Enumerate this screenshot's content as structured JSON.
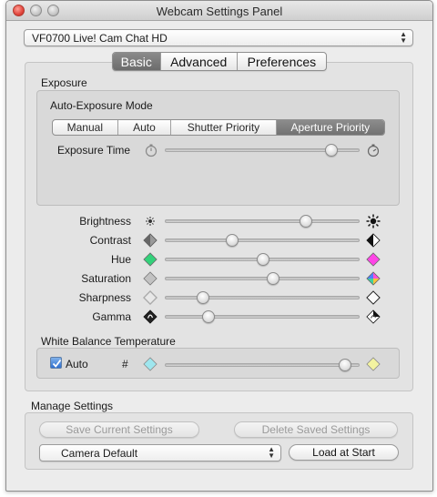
{
  "window": {
    "title": "Webcam Settings Panel"
  },
  "camera_select": {
    "value": "VF0700 Live! Cam Chat HD"
  },
  "tabs": [
    {
      "label": "Basic",
      "selected": true
    },
    {
      "label": "Advanced",
      "selected": false
    },
    {
      "label": "Preferences",
      "selected": false
    }
  ],
  "exposure": {
    "group_label": "Exposure",
    "mode_label": "Auto-Exposure Mode",
    "modes": [
      {
        "label": "Manual",
        "selected": false
      },
      {
        "label": "Auto",
        "selected": false
      },
      {
        "label": "Shutter Priority",
        "selected": false
      },
      {
        "label": "Aperture Priority",
        "selected": true
      }
    ],
    "exposure_time_label": "Exposure Time",
    "exposure_time_value": 0.85
  },
  "image_controls": [
    {
      "label": "Brightness",
      "value": 0.72,
      "icon_left": "sun-small-icon",
      "icon_right": "sun-large-icon"
    },
    {
      "label": "Contrast",
      "value": 0.34,
      "icon_left": "contrast-low-icon",
      "icon_right": "contrast-high-icon"
    },
    {
      "label": "Hue",
      "value": 0.5,
      "icon_left": "hue-green-icon",
      "icon_right": "hue-magenta-icon"
    },
    {
      "label": "Saturation",
      "value": 0.55,
      "icon_left": "saturation-low-icon",
      "icon_right": "saturation-high-icon"
    },
    {
      "label": "Sharpness",
      "value": 0.19,
      "icon_left": "sharpness-low-icon",
      "icon_right": "sharpness-high-icon"
    },
    {
      "label": "Gamma",
      "value": 0.22,
      "icon_left": "gamma-low-icon",
      "icon_right": "gamma-high-icon"
    }
  ],
  "white_balance": {
    "group_label": "White Balance Temperature",
    "auto_label": "Auto",
    "auto_checked": true,
    "hash_label": "#",
    "value": 0.92
  },
  "manage": {
    "group_label": "Manage Settings",
    "save_label": "Save Current Settings",
    "delete_label": "Delete Saved Settings",
    "preset_value": "Camera Default",
    "load_label": "Load at Start"
  },
  "colors": {
    "hue_left": "#33d17a",
    "hue_right": "#ff44e6",
    "wb_left": "#9ee6ee",
    "wb_right": "#f3f3a0",
    "checkbox": "#2f6fcf"
  }
}
